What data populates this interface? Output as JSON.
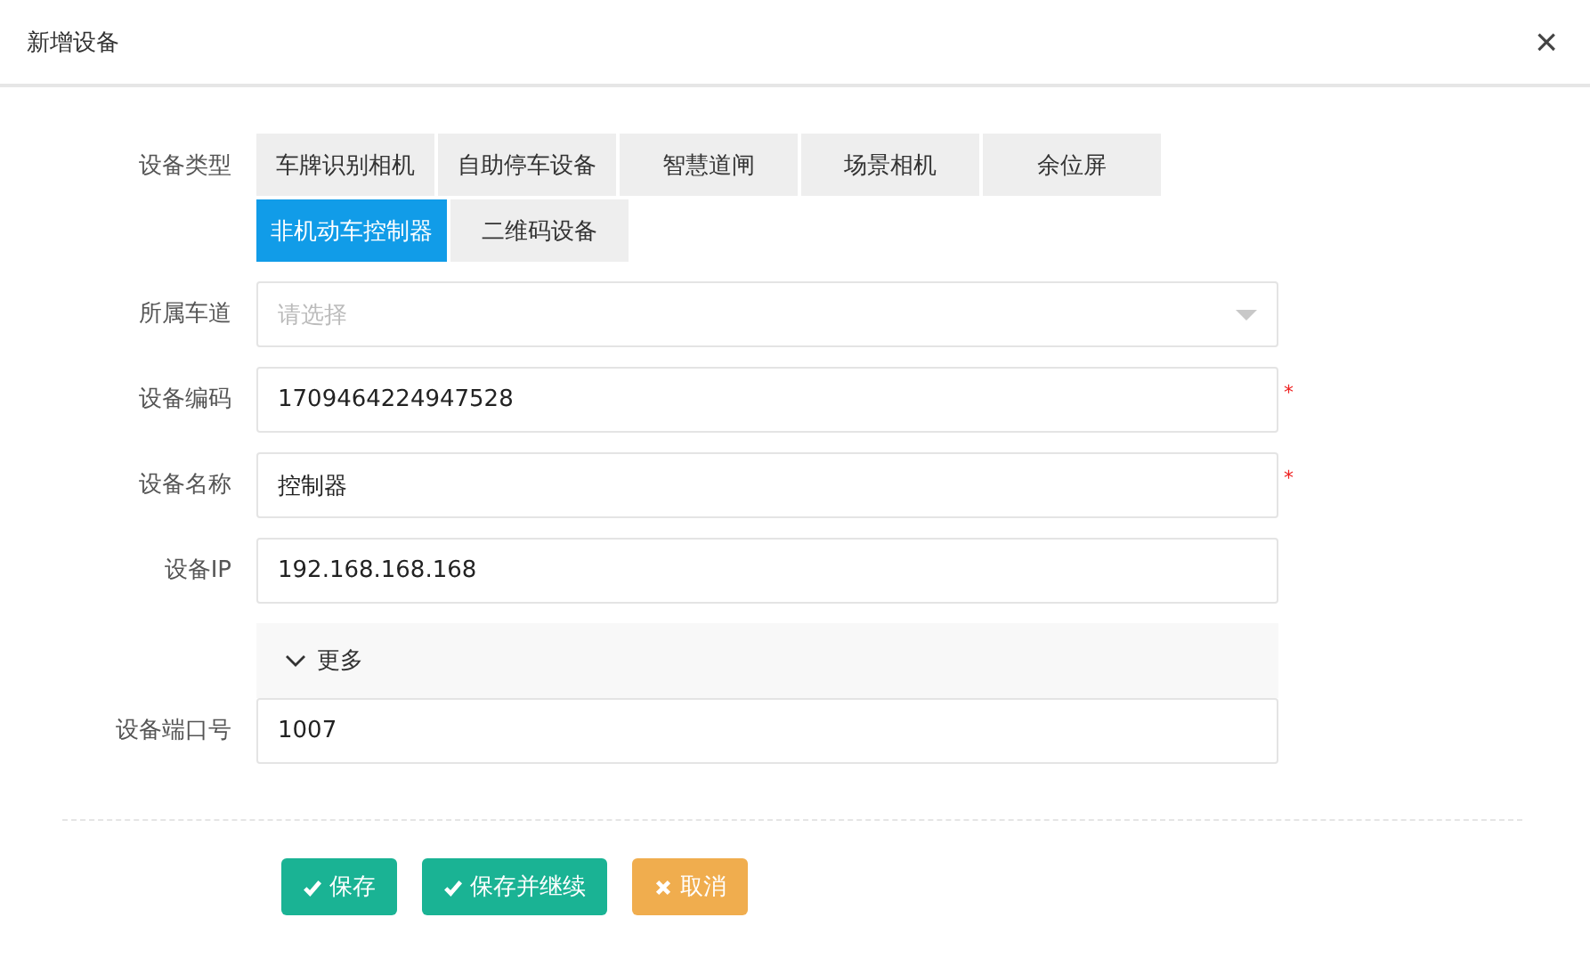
{
  "dialog": {
    "title": "新增设备",
    "close": "×"
  },
  "required_mark": "*",
  "device_type": {
    "label": "设备类型",
    "options": [
      {
        "label": "车牌识别相机",
        "selected": false
      },
      {
        "label": "自助停车设备",
        "selected": false
      },
      {
        "label": "智慧道闸",
        "selected": false
      },
      {
        "label": "场景相机",
        "selected": false
      },
      {
        "label": "余位屏",
        "selected": false
      },
      {
        "label": "非机动车控制器",
        "selected": true
      },
      {
        "label": "二维码设备",
        "selected": false
      }
    ]
  },
  "fields": [
    {
      "label": "所属车道",
      "kind": "select",
      "placeholder": "请选择",
      "required": false
    },
    {
      "label": "设备编码",
      "kind": "input",
      "value": "1709464224947528",
      "required": true
    },
    {
      "label": "设备名称",
      "kind": "input",
      "value": "控制器",
      "required": true
    },
    {
      "label": "设备IP",
      "kind": "input",
      "value": "192.168.168.168",
      "required": false
    }
  ],
  "more": {
    "label": "更多",
    "expanded": true,
    "fields": [
      {
        "label": "设备端口号",
        "kind": "input",
        "value": "1007",
        "required": false
      }
    ]
  },
  "buttons": [
    {
      "label": "保存",
      "kind": "confirm"
    },
    {
      "label": "保存并继续",
      "kind": "confirm"
    },
    {
      "label": "取消",
      "kind": "cancel"
    }
  ]
}
